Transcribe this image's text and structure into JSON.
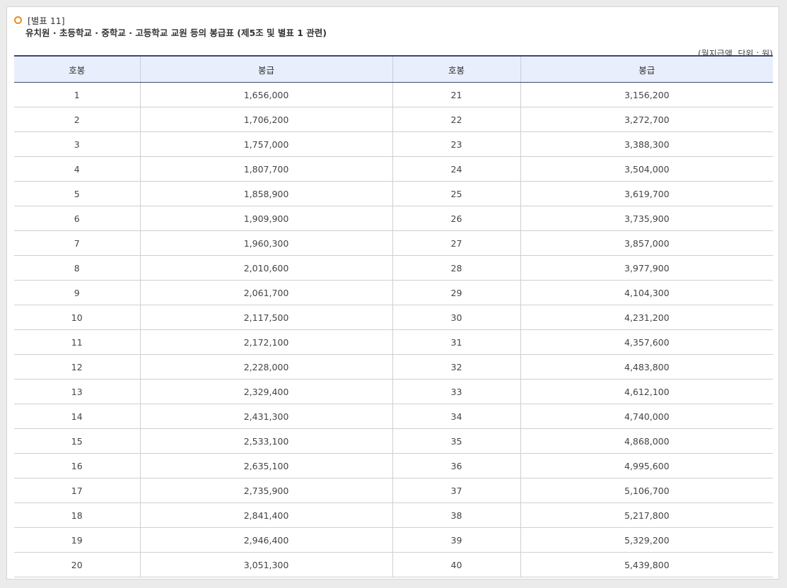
{
  "header": {
    "label": "[별표 11]",
    "title": "유치원 · 초등학교 · 중학교 · 고등학교 교원 등의 봉급표 (제5조 및 별표 1 관련)",
    "unit": "(월지급액, 단위 : 원)"
  },
  "table": {
    "columns": [
      "호봉",
      "봉급",
      "호봉",
      "봉급"
    ],
    "rows": [
      [
        "1",
        "1,656,000",
        "21",
        "3,156,200"
      ],
      [
        "2",
        "1,706,200",
        "22",
        "3,272,700"
      ],
      [
        "3",
        "1,757,000",
        "23",
        "3,388,300"
      ],
      [
        "4",
        "1,807,700",
        "24",
        "3,504,000"
      ],
      [
        "5",
        "1,858,900",
        "25",
        "3,619,700"
      ],
      [
        "6",
        "1,909,900",
        "26",
        "3,735,900"
      ],
      [
        "7",
        "1,960,300",
        "27",
        "3,857,000"
      ],
      [
        "8",
        "2,010,600",
        "28",
        "3,977,900"
      ],
      [
        "9",
        "2,061,700",
        "29",
        "4,104,300"
      ],
      [
        "10",
        "2,117,500",
        "30",
        "4,231,200"
      ],
      [
        "11",
        "2,172,100",
        "31",
        "4,357,600"
      ],
      [
        "12",
        "2,228,000",
        "32",
        "4,483,800"
      ],
      [
        "13",
        "2,329,400",
        "33",
        "4,612,100"
      ],
      [
        "14",
        "2,431,300",
        "34",
        "4,740,000"
      ],
      [
        "15",
        "2,533,100",
        "35",
        "4,868,000"
      ],
      [
        "16",
        "2,635,100",
        "36",
        "4,995,600"
      ],
      [
        "17",
        "2,735,900",
        "37",
        "5,106,700"
      ],
      [
        "18",
        "2,841,400",
        "38",
        "5,217,800"
      ],
      [
        "19",
        "2,946,400",
        "39",
        "5,329,200"
      ],
      [
        "20",
        "3,051,300",
        "40",
        "5,439,800"
      ]
    ]
  },
  "icons": {
    "bullet": "circle-bullet-icon"
  },
  "colors": {
    "bullet": "#f08a1a",
    "header_bg": "#e8eefc",
    "header_border": "#3a4a6a"
  }
}
